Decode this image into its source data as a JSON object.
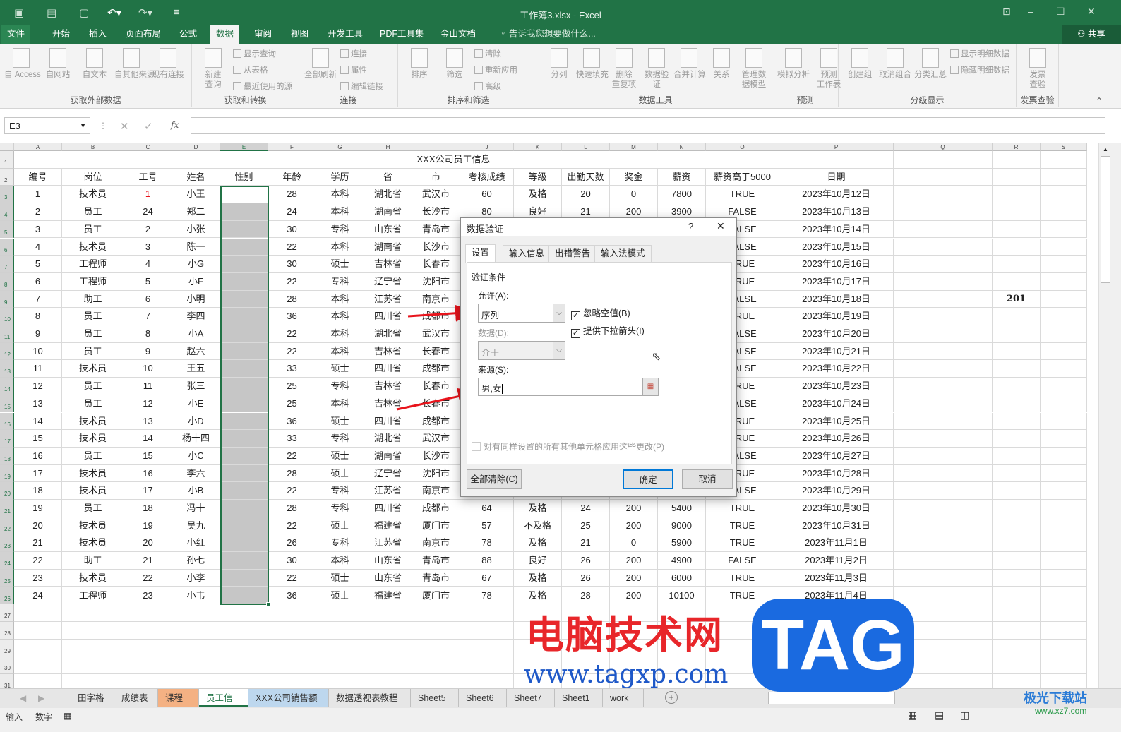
{
  "window": {
    "title": "工作簿3.xlsx - Excel",
    "share": "共享",
    "minimize": "–",
    "maximize": "☐",
    "close": "✕"
  },
  "menu": {
    "tabs": [
      "文件",
      "开始",
      "插入",
      "页面布局",
      "公式",
      "数据",
      "审阅",
      "视图",
      "开发工具",
      "PDF工具集",
      "金山文档"
    ],
    "active": "数据",
    "tell_me": "告诉我您想要做什么..."
  },
  "ribbon": {
    "groups": [
      {
        "label": "获取外部数据",
        "buttons": [
          "自 Access",
          "自网站",
          "自文本",
          "自其他来源",
          "现有连接"
        ]
      },
      {
        "label": "获取和转换",
        "buttons": [
          "新建\n查询"
        ],
        "small": [
          "显示查询",
          "从表格",
          "最近使用的源"
        ]
      },
      {
        "label": "连接",
        "buttons": [
          "全部刷新"
        ],
        "small": [
          "连接",
          "属性",
          "编辑链接"
        ]
      },
      {
        "label": "排序和筛选",
        "buttons": [
          "排序",
          "筛选"
        ],
        "small": [
          "清除",
          "重新应用",
          "高级"
        ]
      },
      {
        "label": "数据工具",
        "buttons": [
          "分列",
          "快速填充",
          "删除\n重复项",
          "数据验\n证",
          "合并计算",
          "关系",
          "管理数\n据模型"
        ]
      },
      {
        "label": "预测",
        "buttons": [
          "模拟分析",
          "预测\n工作表"
        ]
      },
      {
        "label": "分级显示",
        "buttons": [
          "创建组",
          "取消组合",
          "分类汇总"
        ],
        "small": [
          "显示明细数据",
          "隐藏明细数据"
        ]
      },
      {
        "label": "发票查验",
        "buttons": [
          "发票\n查验"
        ]
      }
    ]
  },
  "formula_bar": {
    "name_box": "E3",
    "formula": ""
  },
  "sheet": {
    "columns": [
      "A",
      "B",
      "C",
      "D",
      "E",
      "F",
      "G",
      "H",
      "I",
      "J",
      "K",
      "L",
      "M",
      "N",
      "O",
      "P",
      "Q",
      "R",
      "S"
    ],
    "selected_column": "E",
    "title": "XXX公司员工信息",
    "headers": [
      "编号",
      "岗位",
      "工号",
      "姓名",
      "性别",
      "年龄",
      "学历",
      "省",
      "市",
      "考核成绩",
      "等级",
      "出勤天数",
      "奖金",
      "薪资",
      "薪资高于5000",
      "日期"
    ],
    "rows": [
      [
        "1",
        "技术员",
        "1",
        "小王",
        "",
        "28",
        "本科",
        "湖北省",
        "武汉市",
        "60",
        "及格",
        "20",
        "0",
        "7800",
        "TRUE",
        "2023年10月12日"
      ],
      [
        "2",
        "员工",
        "24",
        "郑二",
        "",
        "24",
        "本科",
        "湖南省",
        "长沙市",
        "80",
        "良好",
        "21",
        "200",
        "3900",
        "FALSE",
        "2023年10月13日"
      ],
      [
        "3",
        "员工",
        "2",
        "小张",
        "",
        "30",
        "专科",
        "山东省",
        "青岛市",
        "",
        "",
        "",
        "",
        "",
        "FALSE",
        "2023年10月14日"
      ],
      [
        "4",
        "技术员",
        "3",
        "陈一",
        "",
        "22",
        "本科",
        "湖南省",
        "长沙市",
        "",
        "",
        "",
        "",
        "",
        "FALSE",
        "2023年10月15日"
      ],
      [
        "5",
        "工程师",
        "4",
        "小G",
        "",
        "30",
        "硕士",
        "吉林省",
        "长春市",
        "",
        "",
        "",
        "",
        "",
        "TRUE",
        "2023年10月16日"
      ],
      [
        "6",
        "工程师",
        "5",
        "小F",
        "",
        "22",
        "专科",
        "辽宁省",
        "沈阳市",
        "",
        "",
        "",
        "",
        "",
        "TRUE",
        "2023年10月17日"
      ],
      [
        "7",
        "助工",
        "6",
        "小明",
        "",
        "28",
        "本科",
        "江苏省",
        "南京市",
        "",
        "",
        "",
        "",
        "",
        "FALSE",
        "2023年10月18日"
      ],
      [
        "8",
        "员工",
        "7",
        "李四",
        "",
        "36",
        "本科",
        "四川省",
        "成都市",
        "",
        "",
        "",
        "",
        "",
        "TRUE",
        "2023年10月19日"
      ],
      [
        "9",
        "员工",
        "8",
        "小A",
        "",
        "22",
        "本科",
        "湖北省",
        "武汉市",
        "",
        "",
        "",
        "",
        "",
        "FALSE",
        "2023年10月20日"
      ],
      [
        "10",
        "员工",
        "9",
        "赵六",
        "",
        "22",
        "本科",
        "吉林省",
        "长春市",
        "",
        "",
        "",
        "",
        "",
        "FALSE",
        "2023年10月21日"
      ],
      [
        "11",
        "技术员",
        "10",
        "王五",
        "",
        "33",
        "硕士",
        "四川省",
        "成都市",
        "",
        "",
        "",
        "",
        "",
        "FALSE",
        "2023年10月22日"
      ],
      [
        "12",
        "员工",
        "11",
        "张三",
        "",
        "25",
        "专科",
        "吉林省",
        "长春市",
        "",
        "",
        "",
        "",
        "",
        "TRUE",
        "2023年10月23日"
      ],
      [
        "13",
        "员工",
        "12",
        "小E",
        "",
        "25",
        "本科",
        "吉林省",
        "长春市",
        "",
        "",
        "",
        "",
        "",
        "FALSE",
        "2023年10月24日"
      ],
      [
        "14",
        "技术员",
        "13",
        "小D",
        "",
        "36",
        "硕士",
        "四川省",
        "成都市",
        "",
        "",
        "",
        "",
        "",
        "TRUE",
        "2023年10月25日"
      ],
      [
        "15",
        "技术员",
        "14",
        "杨十四",
        "",
        "33",
        "专科",
        "湖北省",
        "武汉市",
        "",
        "",
        "",
        "",
        "",
        "TRUE",
        "2023年10月26日"
      ],
      [
        "16",
        "员工",
        "15",
        "小C",
        "",
        "22",
        "硕士",
        "湖南省",
        "长沙市",
        "",
        "",
        "",
        "",
        "",
        "FALSE",
        "2023年10月27日"
      ],
      [
        "17",
        "技术员",
        "16",
        "李六",
        "",
        "28",
        "硕士",
        "辽宁省",
        "沈阳市",
        "",
        "",
        "",
        "",
        "",
        "TRUE",
        "2023年10月28日"
      ],
      [
        "18",
        "技术员",
        "17",
        "小B",
        "",
        "22",
        "专科",
        "江苏省",
        "南京市",
        "",
        "",
        "",
        "",
        "",
        "FALSE",
        "2023年10月29日"
      ],
      [
        "19",
        "员工",
        "18",
        "冯十",
        "",
        "28",
        "专科",
        "四川省",
        "成都市",
        "64",
        "及格",
        "24",
        "200",
        "5400",
        "TRUE",
        "2023年10月30日"
      ],
      [
        "20",
        "技术员",
        "19",
        "吴九",
        "",
        "22",
        "硕士",
        "福建省",
        "厦门市",
        "57",
        "不及格",
        "25",
        "200",
        "9000",
        "TRUE",
        "2023年10月31日"
      ],
      [
        "21",
        "技术员",
        "20",
        "小红",
        "",
        "26",
        "专科",
        "江苏省",
        "南京市",
        "78",
        "及格",
        "21",
        "0",
        "5900",
        "TRUE",
        "2023年11月1日"
      ],
      [
        "22",
        "助工",
        "21",
        "孙七",
        "",
        "30",
        "本科",
        "山东省",
        "青岛市",
        "88",
        "良好",
        "26",
        "200",
        "4900",
        "FALSE",
        "2023年11月2日"
      ],
      [
        "23",
        "技术员",
        "22",
        "小李",
        "",
        "22",
        "硕士",
        "山东省",
        "青岛市",
        "67",
        "及格",
        "26",
        "200",
        "6000",
        "TRUE",
        "2023年11月3日"
      ],
      [
        "24",
        "工程师",
        "23",
        "小韦",
        "",
        "36",
        "硕士",
        "福建省",
        "厦门市",
        "78",
        "及格",
        "28",
        "200",
        "10100",
        "TRUE",
        "2023年11月4日"
      ]
    ],
    "extra_cell": {
      "ref": "R9",
      "value": "201"
    },
    "highlight_color": "#c6c6c6",
    "accent": "#217346"
  },
  "sheet_tabs": {
    "tabs": [
      "田字格",
      "成绩表",
      "课程表",
      "员工信息",
      "XXX公司销售额",
      "数据透视表教程",
      "Sheet5",
      "Sheet6",
      "Sheet7",
      "Sheet1",
      "work"
    ],
    "active": "员工信息",
    "add": "+"
  },
  "status": {
    "mode": "输入",
    "num": "数字"
  },
  "dialog": {
    "title": "数据验证",
    "help": "?",
    "close": "✕",
    "tabs": [
      "设置",
      "输入信息",
      "出错警告",
      "输入法模式"
    ],
    "active_tab": "设置",
    "section": "验证条件",
    "allow_label": "允许(A):",
    "allow_value": "序列",
    "data_label": "数据(D):",
    "data_value": "介于",
    "ignore_blank": {
      "label": "忽略空值(B)",
      "checked": true
    },
    "dropdown": {
      "label": "提供下拉箭头(I)",
      "checked": true
    },
    "source_label": "来源(S):",
    "source_value": "男,女",
    "apply_all": {
      "label": "对有同样设置的所有其他单元格应用这些更改(P)",
      "checked": false
    },
    "clear_all": "全部清除(C)",
    "ok": "确定",
    "cancel": "取消"
  },
  "watermark": {
    "text1": "电脑技术网",
    "text2": "www.tagxp.com",
    "tag": "TAG",
    "corner": "极光下载站",
    "corner_url": "www.xz7.com"
  }
}
